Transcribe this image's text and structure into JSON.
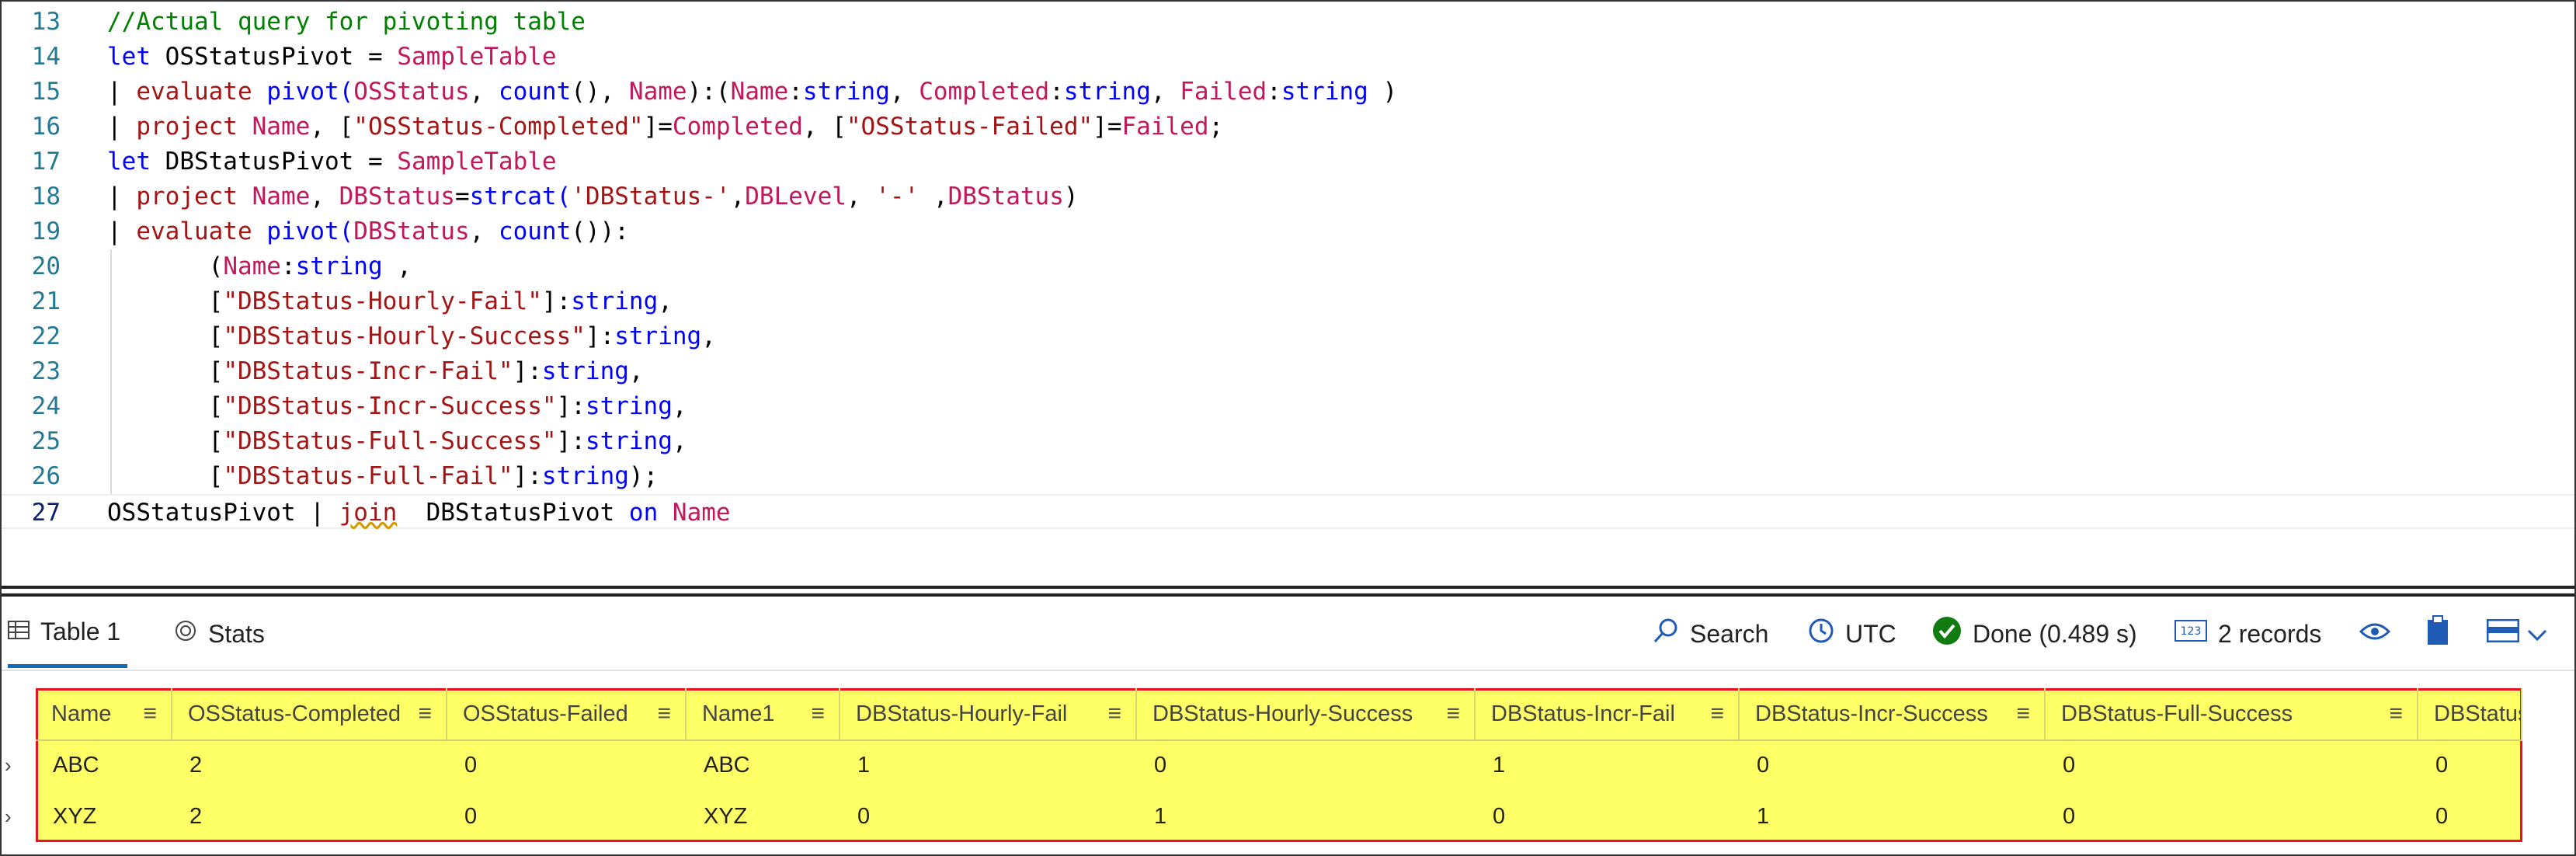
{
  "editor": {
    "lines": [
      {
        "num": "13",
        "tokens": [
          {
            "t": "//Actual query for pivoting table",
            "c": "comment"
          }
        ]
      },
      {
        "num": "14",
        "tokens": [
          {
            "t": "let ",
            "c": "kw"
          },
          {
            "t": "OSStatusPivot = ",
            "c": "op"
          },
          {
            "t": "SampleTable",
            "c": "table"
          }
        ]
      },
      {
        "num": "15",
        "tokens": [
          {
            "t": "| ",
            "c": "op"
          },
          {
            "t": "evaluate ",
            "c": "cmd"
          },
          {
            "t": "pivot(",
            "c": "fn"
          },
          {
            "t": "OSStatus",
            "c": "col"
          },
          {
            "t": ", ",
            "c": "op"
          },
          {
            "t": "count",
            "c": "fn"
          },
          {
            "t": "(), ",
            "c": "op"
          },
          {
            "t": "Name",
            "c": "col"
          },
          {
            "t": "):(",
            "c": "op"
          },
          {
            "t": "Name",
            "c": "col"
          },
          {
            "t": ":",
            "c": "op"
          },
          {
            "t": "string",
            "c": "type"
          },
          {
            "t": ", ",
            "c": "op"
          },
          {
            "t": "Completed",
            "c": "col"
          },
          {
            "t": ":",
            "c": "op"
          },
          {
            "t": "string",
            "c": "type"
          },
          {
            "t": ", ",
            "c": "op"
          },
          {
            "t": "Failed",
            "c": "col"
          },
          {
            "t": ":",
            "c": "op"
          },
          {
            "t": "string",
            "c": "type"
          },
          {
            "t": " )",
            "c": "op"
          }
        ]
      },
      {
        "num": "16",
        "tokens": [
          {
            "t": "| ",
            "c": "op"
          },
          {
            "t": "project ",
            "c": "cmd"
          },
          {
            "t": "Name",
            "c": "col"
          },
          {
            "t": ", [",
            "c": "op"
          },
          {
            "t": "\"OSStatus-Completed\"",
            "c": "str"
          },
          {
            "t": "]=",
            "c": "op"
          },
          {
            "t": "Completed",
            "c": "col"
          },
          {
            "t": ", [",
            "c": "op"
          },
          {
            "t": "\"OSStatus-Failed\"",
            "c": "str"
          },
          {
            "t": "]=",
            "c": "op"
          },
          {
            "t": "Failed",
            "c": "col"
          },
          {
            "t": ";",
            "c": "op"
          }
        ]
      },
      {
        "num": "17",
        "tokens": [
          {
            "t": "let ",
            "c": "kw"
          },
          {
            "t": "DBStatusPivot = ",
            "c": "op"
          },
          {
            "t": "SampleTable",
            "c": "table"
          }
        ]
      },
      {
        "num": "18",
        "tokens": [
          {
            "t": "| ",
            "c": "op"
          },
          {
            "t": "project ",
            "c": "cmd"
          },
          {
            "t": "Name",
            "c": "col"
          },
          {
            "t": ", ",
            "c": "op"
          },
          {
            "t": "DBStatus",
            "c": "col"
          },
          {
            "t": "=",
            "c": "op"
          },
          {
            "t": "strcat(",
            "c": "fn"
          },
          {
            "t": "'DBStatus-'",
            "c": "str"
          },
          {
            "t": ",",
            "c": "op"
          },
          {
            "t": "DBLevel",
            "c": "col"
          },
          {
            "t": ", ",
            "c": "op"
          },
          {
            "t": "'-'",
            "c": "str"
          },
          {
            "t": " ,",
            "c": "op"
          },
          {
            "t": "DBStatus",
            "c": "col"
          },
          {
            "t": ")",
            "c": "op"
          }
        ]
      },
      {
        "num": "19",
        "tokens": [
          {
            "t": "| ",
            "c": "op"
          },
          {
            "t": "evaluate ",
            "c": "cmd"
          },
          {
            "t": "pivot(",
            "c": "fn"
          },
          {
            "t": "DBStatus",
            "c": "col"
          },
          {
            "t": ", ",
            "c": "op"
          },
          {
            "t": "count",
            "c": "fn"
          },
          {
            "t": "()):",
            "c": "op"
          }
        ]
      },
      {
        "num": "20",
        "tokens": [
          {
            "t": "       (",
            "c": "op"
          },
          {
            "t": "Name",
            "c": "col"
          },
          {
            "t": ":",
            "c": "op"
          },
          {
            "t": "string",
            "c": "type"
          },
          {
            "t": " ,",
            "c": "op"
          }
        ]
      },
      {
        "num": "21",
        "tokens": [
          {
            "t": "       [",
            "c": "op"
          },
          {
            "t": "\"DBStatus-Hourly-Fail\"",
            "c": "str"
          },
          {
            "t": "]:",
            "c": "op"
          },
          {
            "t": "string",
            "c": "type"
          },
          {
            "t": ",",
            "c": "op"
          }
        ]
      },
      {
        "num": "22",
        "tokens": [
          {
            "t": "       [",
            "c": "op"
          },
          {
            "t": "\"DBStatus-Hourly-Success\"",
            "c": "str"
          },
          {
            "t": "]:",
            "c": "op"
          },
          {
            "t": "string",
            "c": "type"
          },
          {
            "t": ",",
            "c": "op"
          }
        ]
      },
      {
        "num": "23",
        "tokens": [
          {
            "t": "       [",
            "c": "op"
          },
          {
            "t": "\"DBStatus-Incr-Fail\"",
            "c": "str"
          },
          {
            "t": "]:",
            "c": "op"
          },
          {
            "t": "string",
            "c": "type"
          },
          {
            "t": ",",
            "c": "op"
          }
        ]
      },
      {
        "num": "24",
        "tokens": [
          {
            "t": "       [",
            "c": "op"
          },
          {
            "t": "\"DBStatus-Incr-Success\"",
            "c": "str"
          },
          {
            "t": "]:",
            "c": "op"
          },
          {
            "t": "string",
            "c": "type"
          },
          {
            "t": ",",
            "c": "op"
          }
        ]
      },
      {
        "num": "25",
        "tokens": [
          {
            "t": "       [",
            "c": "op"
          },
          {
            "t": "\"DBStatus-Full-Success\"",
            "c": "str"
          },
          {
            "t": "]:",
            "c": "op"
          },
          {
            "t": "string",
            "c": "type"
          },
          {
            "t": ",",
            "c": "op"
          }
        ]
      },
      {
        "num": "26",
        "tokens": [
          {
            "t": "       [",
            "c": "op"
          },
          {
            "t": "\"DBStatus-Full-Fail\"",
            "c": "str"
          },
          {
            "t": "]:",
            "c": "op"
          },
          {
            "t": "string",
            "c": "type"
          },
          {
            "t": ");",
            "c": "op"
          }
        ]
      },
      {
        "num": "27",
        "tokens": [
          {
            "t": "OSStatusPivot | ",
            "c": "op"
          },
          {
            "t": "join",
            "c": "err"
          },
          {
            "t": "  DBStatusPivot ",
            "c": "op"
          },
          {
            "t": "on ",
            "c": "kw"
          },
          {
            "t": "Name",
            "c": "col"
          }
        ]
      }
    ]
  },
  "toolbar": {
    "tab_table": "Table 1",
    "tab_stats": "Stats",
    "search_label": "Search",
    "timezone_label": "UTC",
    "status_label": "Done (0.489 s)",
    "records_label": "2 records",
    "records_icon_text": "123"
  },
  "grid": {
    "columns": [
      "Name",
      "OSStatus-Completed",
      "OSStatus-Failed",
      "Name1",
      "DBStatus-Hourly-Fail",
      "DBStatus-Hourly-Success",
      "DBStatus-Incr-Fail",
      "DBStatus-Incr-Success",
      "DBStatus-Full-Success",
      "DBStatus-F"
    ],
    "rows": [
      [
        "ABC",
        "2",
        "0",
        "ABC",
        "1",
        "0",
        "1",
        "0",
        "0",
        "0"
      ],
      [
        "XYZ",
        "2",
        "0",
        "XYZ",
        "0",
        "1",
        "0",
        "1",
        "0",
        "0"
      ]
    ]
  },
  "colors": {
    "accent": "#0f6cbd",
    "highlight": "#ffff66",
    "highlight_border": "#e81224",
    "done_green": "#107c10"
  },
  "icons": [
    "table-icon",
    "stats-icon",
    "search-icon",
    "clock-icon",
    "check-circle-icon",
    "records-icon",
    "eye-icon",
    "clipboard-icon",
    "layout-icon",
    "chevron-down-icon",
    "column-menu-icon",
    "row-expander-icon"
  ]
}
